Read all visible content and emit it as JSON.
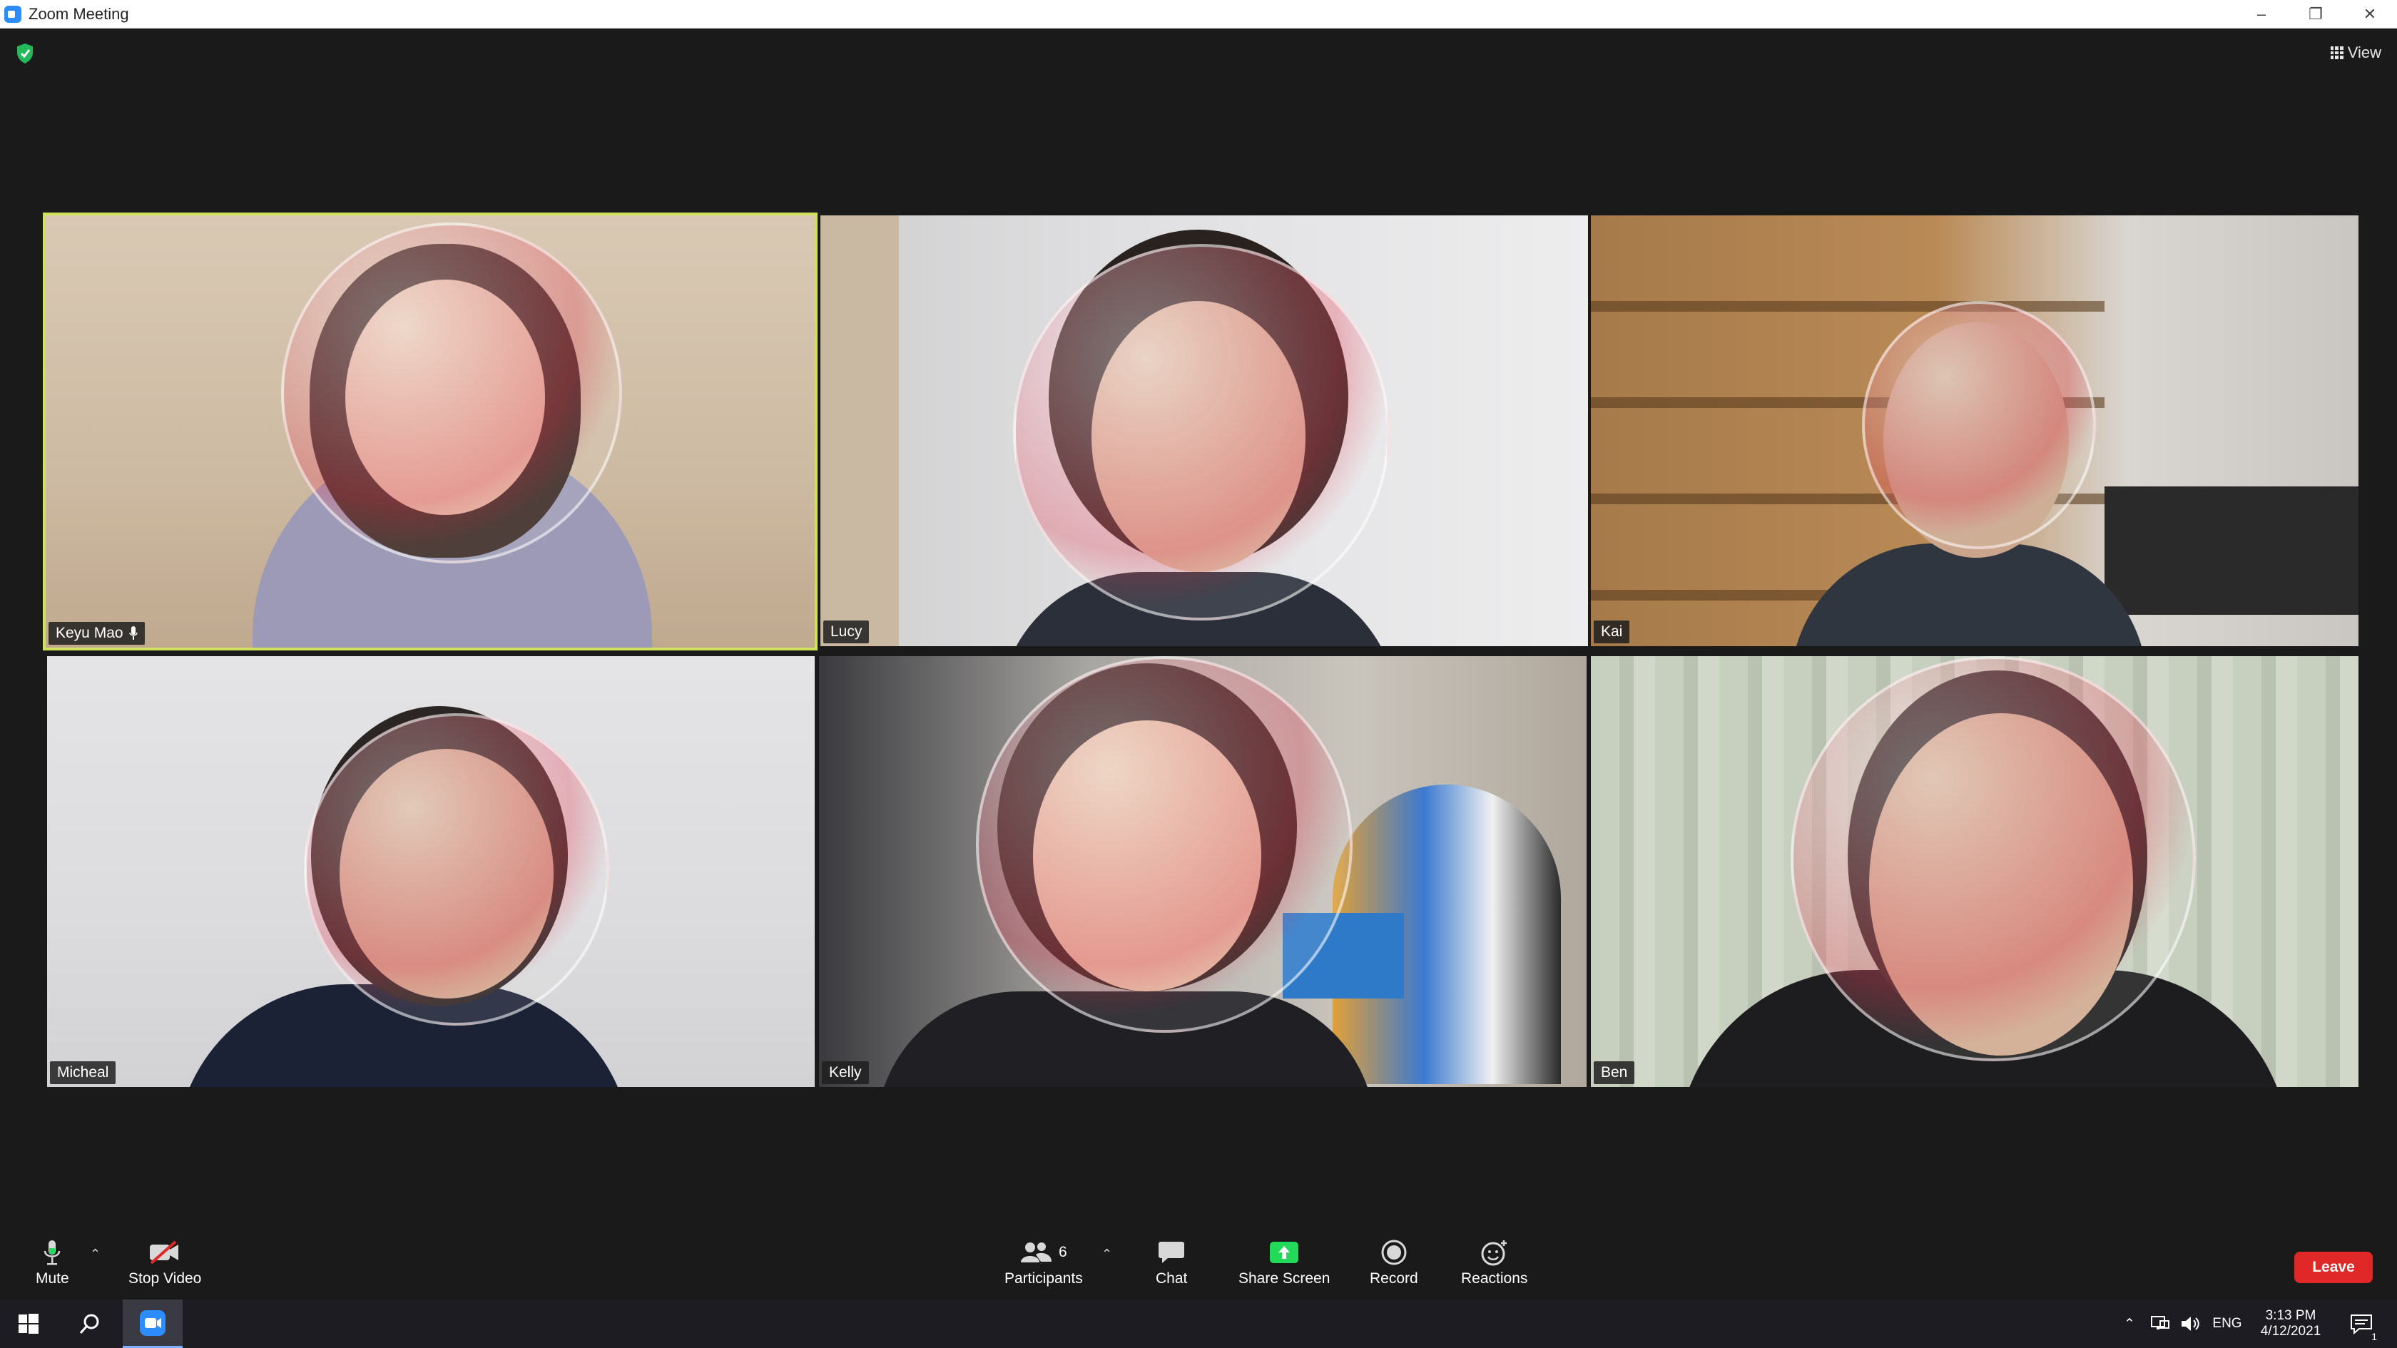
{
  "window": {
    "title": "Zoom Meeting"
  },
  "top_bar": {
    "view_label": "View"
  },
  "participants": [
    {
      "name": "Keyu Mao",
      "speaking": true,
      "muted_icon": "mic-icon"
    },
    {
      "name": "Lucy"
    },
    {
      "name": "Kai"
    },
    {
      "name": "Micheal"
    },
    {
      "name": "Kelly"
    },
    {
      "name": "Ben"
    }
  ],
  "toolbar": {
    "mute": "Mute",
    "stop_video": "Stop Video",
    "participants": "Participants",
    "participants_count": "6",
    "chat": "Chat",
    "share_screen": "Share Screen",
    "record": "Record",
    "reactions": "Reactions",
    "leave": "Leave"
  },
  "taskbar": {
    "language": "ENG",
    "time": "3:13 PM",
    "date": "4/12/2021",
    "notification_count": "1"
  },
  "colors": {
    "active_speaker_border": "#cfe05b",
    "share_screen_green": "#23d959",
    "leave_red": "#e02828",
    "zoom_blue": "#2d8cff",
    "security_green": "#23b85a"
  }
}
